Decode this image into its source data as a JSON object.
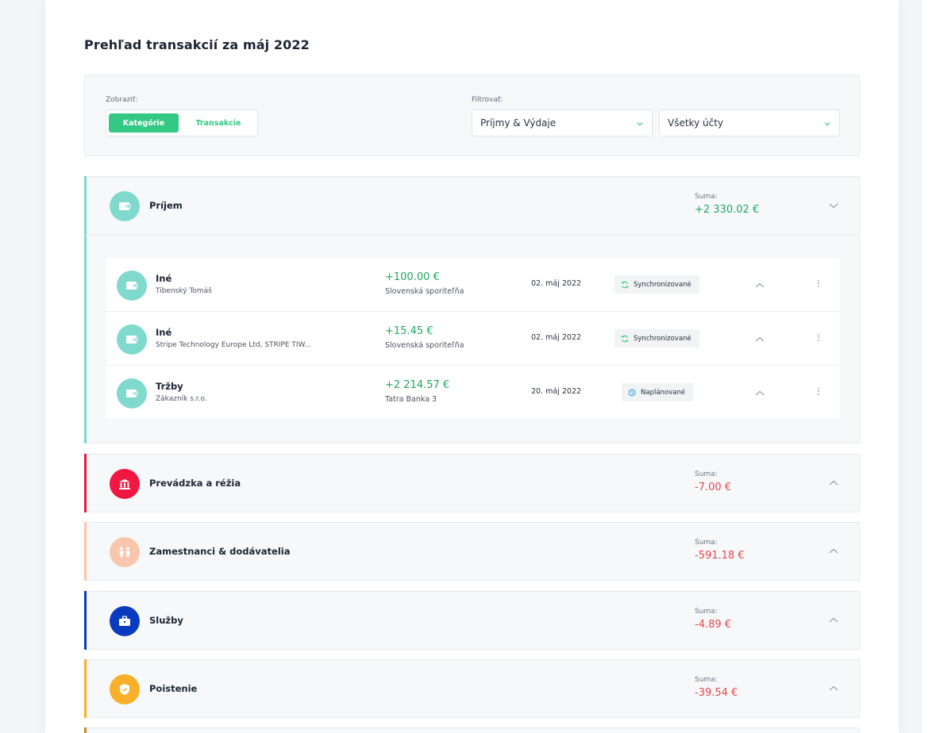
{
  "page": {
    "title": "Prehľad transakcií za máj 2022"
  },
  "filters": {
    "show_label": "Zobraziť:",
    "view_tabs": [
      {
        "label": "Kategórie",
        "active": true
      },
      {
        "label": "Transakcie",
        "active": false
      }
    ],
    "filter_label": "Filtrovať:",
    "type_select": {
      "value": "Príjmy & Výdaje"
    },
    "account_select": {
      "value": "Všetky účty"
    }
  },
  "colors": {
    "accent": "#33c985",
    "positive": "#1fa762",
    "negative": "#e5484d"
  },
  "categories": [
    {
      "name": "Príjem",
      "sum_label": "Suma:",
      "sum": "+2 330.02 €",
      "sign": "positive",
      "color": "#7fd9cd",
      "icon": "wallet-icon",
      "expanded": true,
      "transactions": [
        {
          "name": "Iné",
          "counterparty": "Tibenský Tomáš",
          "amount": "+100.00 €",
          "bank": "Slovenská sporiteľňa",
          "date": "02. máj 2022",
          "status": "Synchronizované",
          "status_icon": "sync-icon"
        },
        {
          "name": "Iné",
          "counterparty": "Stripe Technology Europe Ltd, STRIPE TIW...",
          "amount": "+15.45 €",
          "bank": "Slovenská sporiteľňa",
          "date": "02. máj 2022",
          "status": "Synchronizované",
          "status_icon": "sync-icon"
        },
        {
          "name": "Tržby",
          "counterparty": "Zákazník s.r.o.",
          "amount": "+2 214.57 €",
          "bank": "Tatra Banka 3",
          "date": "20. máj 2022",
          "status": "Naplánované",
          "status_icon": "clock-icon"
        }
      ]
    },
    {
      "name": "Prevádzka a réžia",
      "sum_label": "Suma:",
      "sum": "-7.00 €",
      "sign": "negative",
      "color": "#f01840",
      "icon": "bank-icon",
      "expanded": false
    },
    {
      "name": "Zamestnanci & dodávatelia",
      "sum_label": "Suma:",
      "sum": "-591.18 €",
      "sign": "negative",
      "color": "#f8c6ad",
      "icon": "people-icon",
      "expanded": false
    },
    {
      "name": "Služby",
      "sum_label": "Suma:",
      "sum": "-4.89 €",
      "sign": "negative",
      "color": "#0a3bbf",
      "icon": "briefcase-icon",
      "expanded": false
    },
    {
      "name": "Poistenie",
      "sum_label": "Suma:",
      "sum": "-39.54 €",
      "sign": "negative",
      "color": "#f8b02a",
      "icon": "shield-icon",
      "expanded": false
    }
  ]
}
